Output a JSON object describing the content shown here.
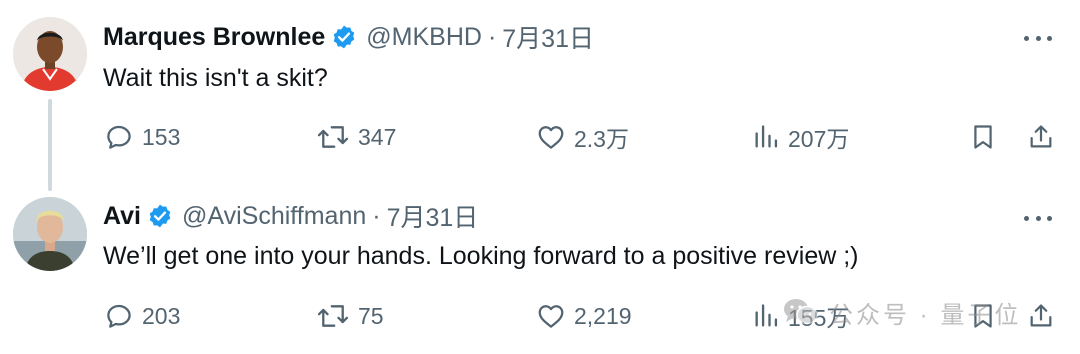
{
  "tweets": [
    {
      "name": "Marques Brownlee",
      "handle": "@MKBHD",
      "separator": "·",
      "date": "7月31日",
      "text": "Wait this isn't a skit?",
      "replies": "153",
      "retweets": "347",
      "likes": "2.3万",
      "views": "207万"
    },
    {
      "name": "Avi",
      "handle": "@AviSchiffmann",
      "separator": "·",
      "date": "7月31日",
      "text": "We’ll get one into your hands. Looking forward to a positive review ;)",
      "replies": "203",
      "retweets": "75",
      "likes": "2,219",
      "views": "155万"
    }
  ],
  "watermark": {
    "text": "公众号 · 量子位"
  },
  "colors": {
    "text": "#0f1419",
    "secondary": "#536471",
    "verified": "#1d9bf0",
    "thread_line": "#cfd9de"
  },
  "icons": [
    "reply-icon",
    "retweet-icon",
    "like-icon",
    "views-icon",
    "bookmark-icon",
    "share-icon",
    "verified-badge-icon",
    "more-icon",
    "wechat-icon"
  ]
}
